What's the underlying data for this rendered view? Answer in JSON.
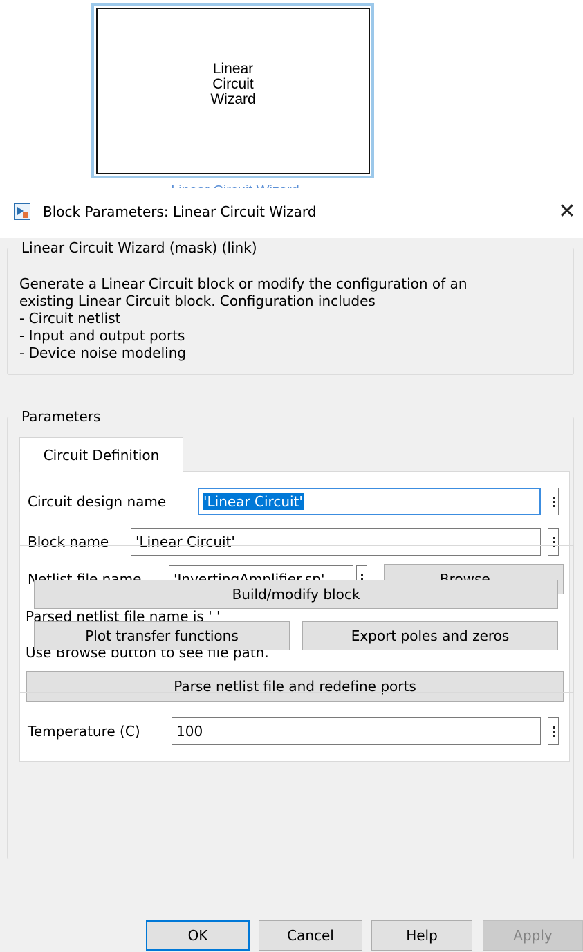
{
  "canvas": {
    "block_label": "Linear\nCircuit\nWizard",
    "block_caption": "Linear Circuit Wizard"
  },
  "dialog": {
    "title": "Block Parameters: Linear Circuit Wizard",
    "close_glyph": "✕",
    "mask_group": {
      "legend": "Linear Circuit Wizard (mask) (link)",
      "description": "Generate a Linear Circuit block or modify the configuration of an\nexisting Linear Circuit block. Configuration includes\n- Circuit netlist\n- Input and output ports\n- Device noise modeling"
    },
    "parameters": {
      "legend": "Parameters",
      "tab_label": "Circuit Definition",
      "circuit_design_name": {
        "label": "Circuit design name",
        "value": "'Linear Circuit'"
      },
      "block_name": {
        "label": "Block name",
        "value": "'Linear Circuit'"
      },
      "netlist_file_name": {
        "label": "Netlist file name",
        "value": "'InvertingAmplifier.sp'"
      },
      "browse_button": "Browse ...",
      "parsed_info": "Parsed netlist file name is ' '",
      "browse_hint": "Use Browse button to see file path.",
      "parse_button": "Parse netlist file and redefine ports",
      "temperature": {
        "label": "Temperature (C)",
        "value": "100"
      }
    },
    "actions": {
      "build_button": "Build/modify block",
      "plot_button": "Plot transfer functions",
      "export_button": "Export poles and zeros"
    },
    "footer": {
      "ok": "OK",
      "cancel": "Cancel",
      "help": "Help",
      "apply": "Apply"
    }
  },
  "icons": [
    "simulink-block-icon",
    "close-icon",
    "more-options-icon"
  ],
  "colors": {
    "selection": "#0078d7",
    "focus_border": "#3c8de0",
    "block_selected_border": "#9cc8ea"
  }
}
